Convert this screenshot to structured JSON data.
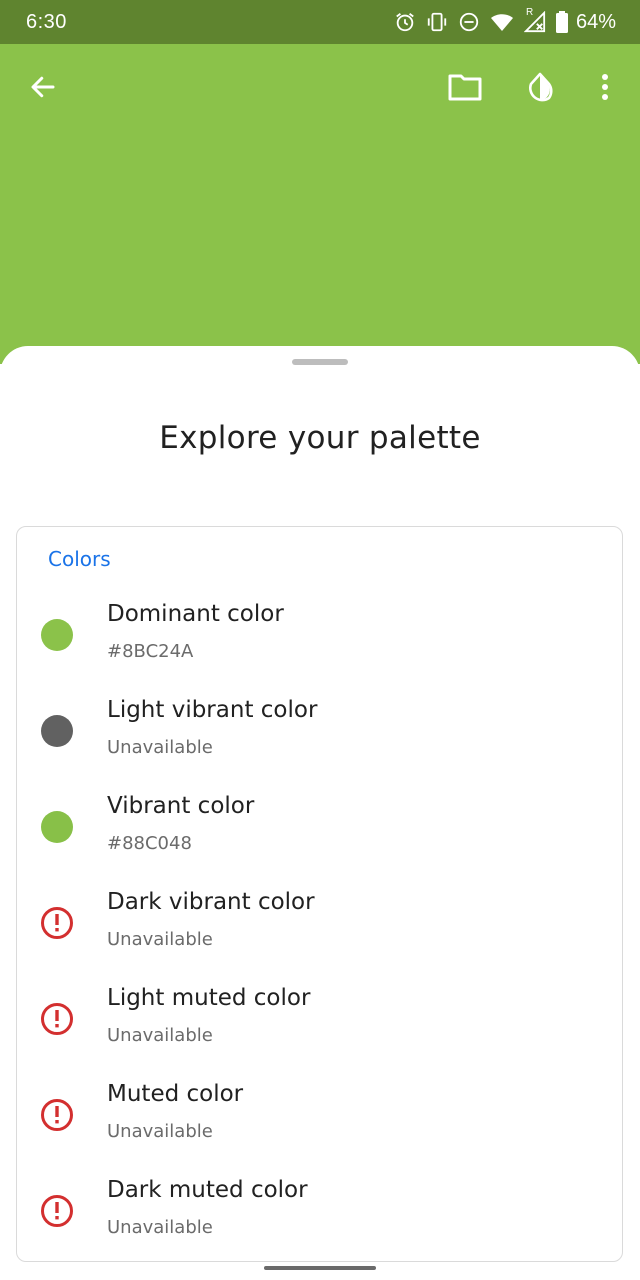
{
  "status": {
    "time": "6:30",
    "battery": "64%",
    "icons": [
      "alarm-icon",
      "vibrate-icon",
      "dnd-icon",
      "wifi-icon",
      "signal-icon",
      "battery-icon"
    ],
    "signal_tag": "R"
  },
  "toolbar": {
    "back_icon": "arrow-back-icon",
    "actions": [
      "folder-icon",
      "invert-colors-icon",
      "more-vert-icon"
    ]
  },
  "colors": {
    "hero": "#8BC24A",
    "status_bar": "#5F842F",
    "accent": "#1A73E8",
    "warning": "#D32F2F"
  },
  "sheet": {
    "title": "Explore your palette",
    "card_title": "Colors",
    "items": [
      {
        "name": "Dominant color",
        "value": "#8BC24A",
        "swatch": "#8BC24A",
        "available": true
      },
      {
        "name": "Light vibrant color",
        "value": "Unavailable",
        "swatch": "#616161",
        "available": true
      },
      {
        "name": "Vibrant color",
        "value": "#88C048",
        "swatch": "#88C048",
        "available": true
      },
      {
        "name": "Dark vibrant color",
        "value": "Unavailable",
        "swatch": null,
        "available": false
      },
      {
        "name": "Light muted color",
        "value": "Unavailable",
        "swatch": null,
        "available": false
      },
      {
        "name": "Muted color",
        "value": "Unavailable",
        "swatch": null,
        "available": false
      },
      {
        "name": "Dark muted color",
        "value": "Unavailable",
        "swatch": null,
        "available": false
      }
    ]
  }
}
